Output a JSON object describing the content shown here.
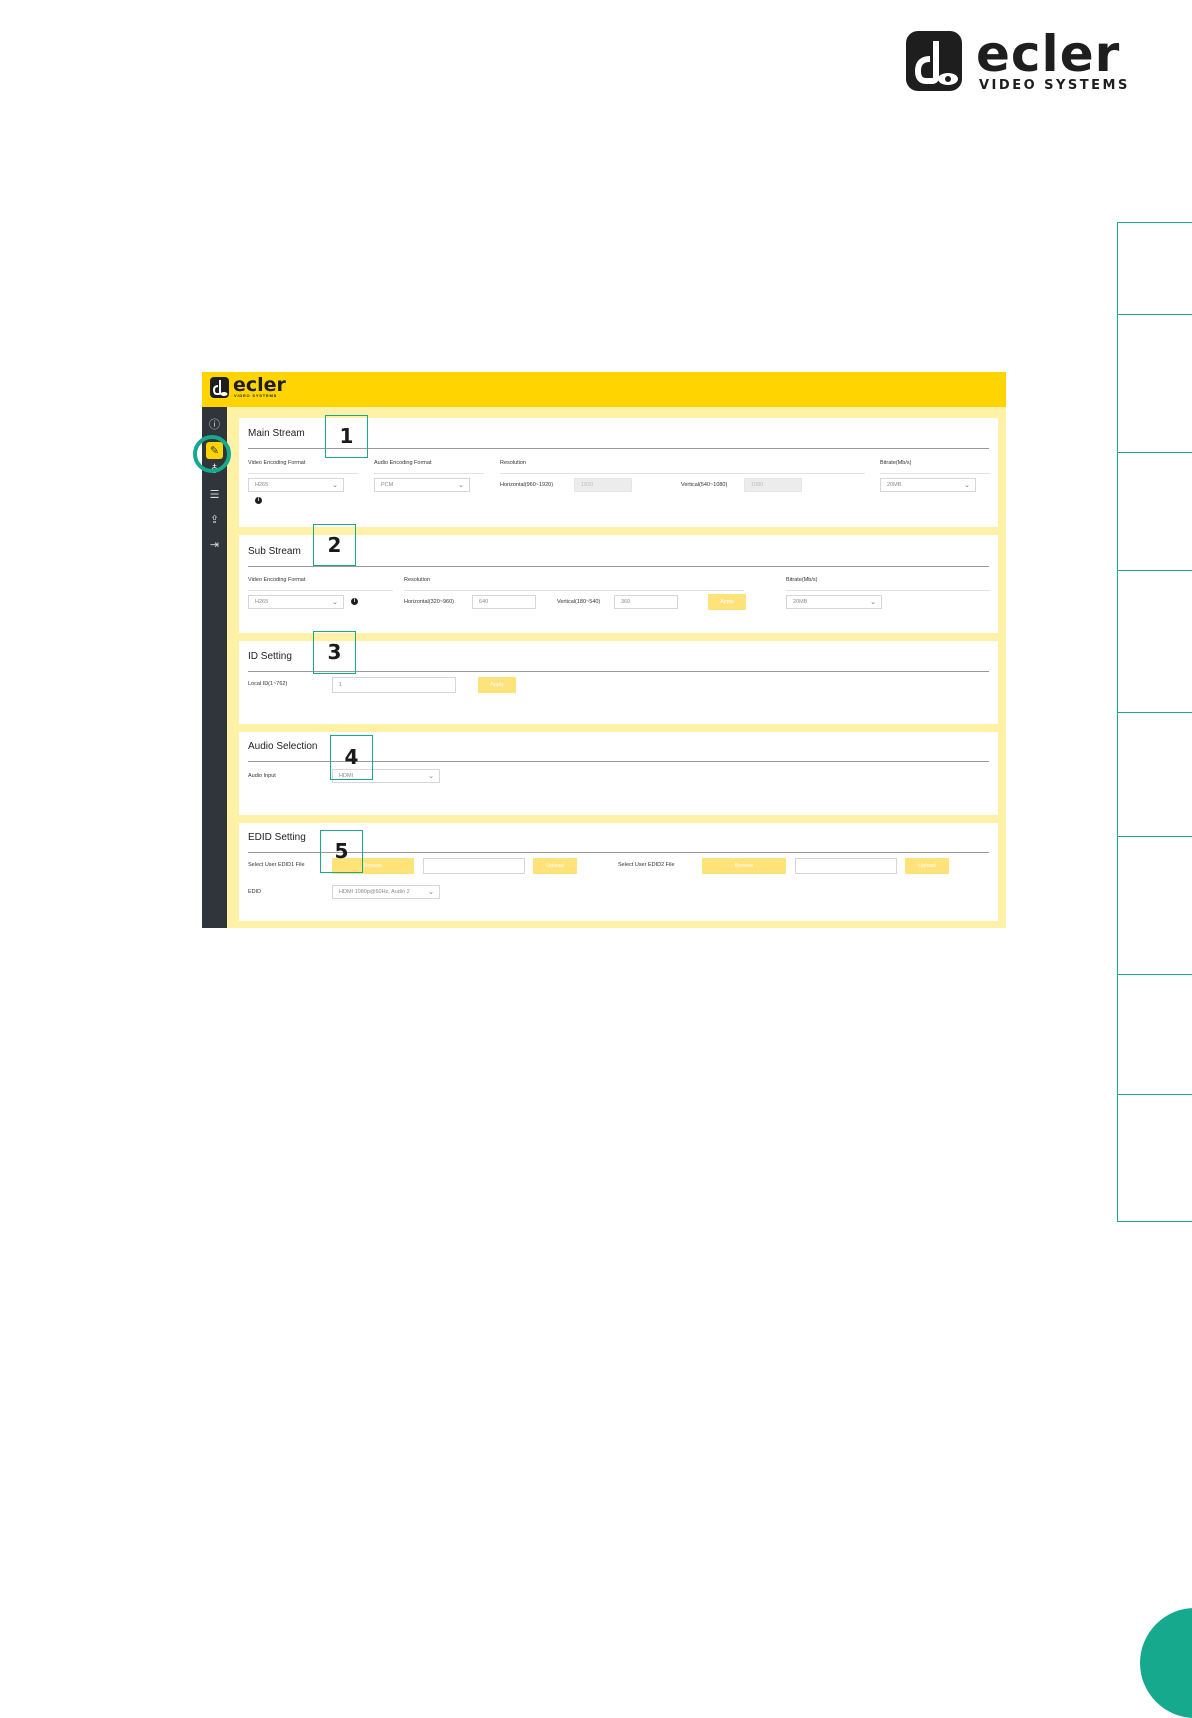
{
  "brand": {
    "name": "ecler",
    "subtitle": "VIDEO SYSTEMS"
  },
  "app": {
    "logo": {
      "name": "ecler",
      "subtitle": "VIDEO SYSTEMS"
    },
    "sidebar_icons": [
      "info-icon",
      "settings-pen-icon",
      "bulb-icon",
      "sliders-icon",
      "upload-icon",
      "logout-icon"
    ],
    "active_sidebar_icon": "settings-pen-icon"
  },
  "main_stream": {
    "title": "Main Stream",
    "callout": "1",
    "video_encoding_label": "Video Encoding Format",
    "video_encoding_value": "H265",
    "audio_encoding_label": "Audio Encoding Format",
    "audio_encoding_value": "PCM",
    "resolution_label": "Resolution",
    "horizontal_label": "Horizontal(960~1920)",
    "horizontal_value": "1920",
    "vertical_label": "Vertical(540~1080)",
    "vertical_value": "1080",
    "bitrate_label": "Bitrate(Mb/s)",
    "bitrate_value": "20MB"
  },
  "sub_stream": {
    "title": "Sub Stream",
    "callout": "2",
    "video_encoding_label": "Video Encoding Format",
    "video_encoding_value": "H265",
    "resolution_label": "Resolution",
    "horizontal_label": "Horizontal(320~960)",
    "horizontal_value": "640",
    "vertical_label": "Vertical(180~540)",
    "vertical_value": "360",
    "apply_label": "Apply",
    "bitrate_label": "Bitrate(Mb/s)",
    "bitrate_value": "20MB"
  },
  "id_setting": {
    "title": "ID Setting",
    "callout": "3",
    "local_id_label": "Local ID(1~762)",
    "local_id_value": "1",
    "apply_label": "Apply"
  },
  "audio_selection": {
    "title": "Audio Selection",
    "callout": "4",
    "audio_input_label": "Audio Input",
    "audio_input_value": "HDMI"
  },
  "edid_setting": {
    "title": "EDID Setting",
    "callout": "5",
    "edid1_label": "Select User EDID1 File",
    "edid1_browse": "Browse",
    "edid1_upload": "Upload",
    "edid2_label": "Select User EDID2 File",
    "edid2_browse": "Browse",
    "edid2_upload": "Upload",
    "edid_label": "EDID",
    "edid_value": "HDMI 1080p@60Hz, Audio 2"
  },
  "colors": {
    "accent_yellow": "#ffd400",
    "callout_teal": "#17a98e",
    "sidebar_dark": "#2f353b"
  }
}
